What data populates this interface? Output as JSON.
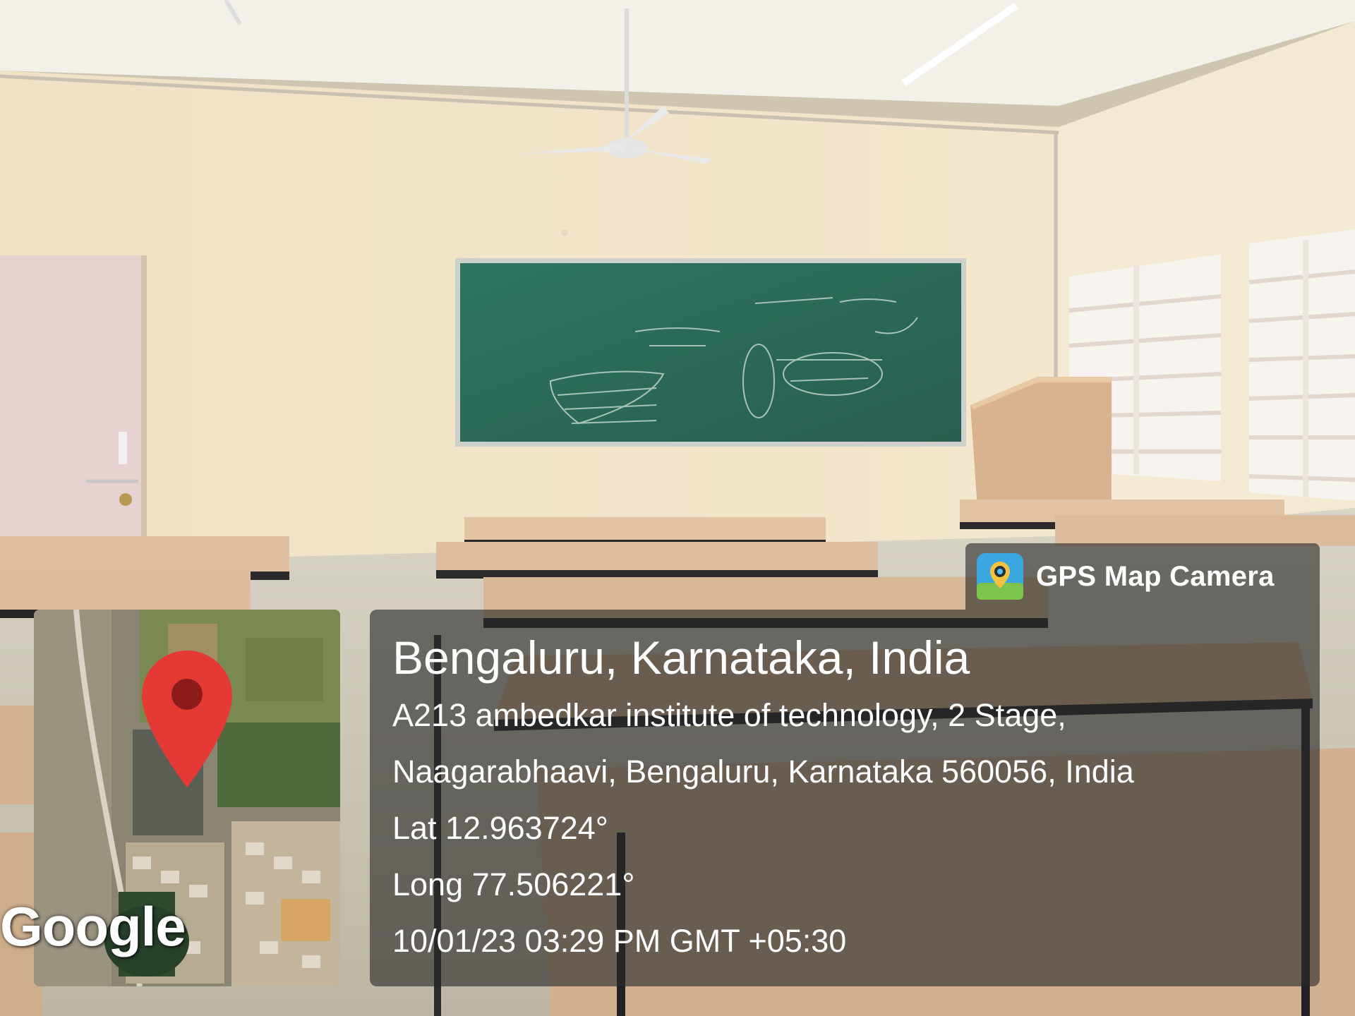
{
  "app": {
    "name": "GPS Map Camera",
    "icon": "gps-camera-icon"
  },
  "location": {
    "title": "Bengaluru, Karnataka, India",
    "address_line_1": "A213 ambedkar institute of technology, 2 Stage,",
    "address_line_2": "Naagarabhaavi, Bengaluru, Karnataka 560056, India",
    "latitude": "Lat 12.963724°",
    "longitude": "Long 77.506221°",
    "timestamp": "10/01/23 03:29 PM GMT +05:30"
  },
  "map": {
    "provider_logo": "Google",
    "marker_icon": "map-pin-icon",
    "marker_color": "#e53935"
  },
  "colors": {
    "overlay": "#282828",
    "wall": "#efe3c8",
    "chalkboard": "#2e6b58",
    "desk_top": "#d9b99a"
  }
}
